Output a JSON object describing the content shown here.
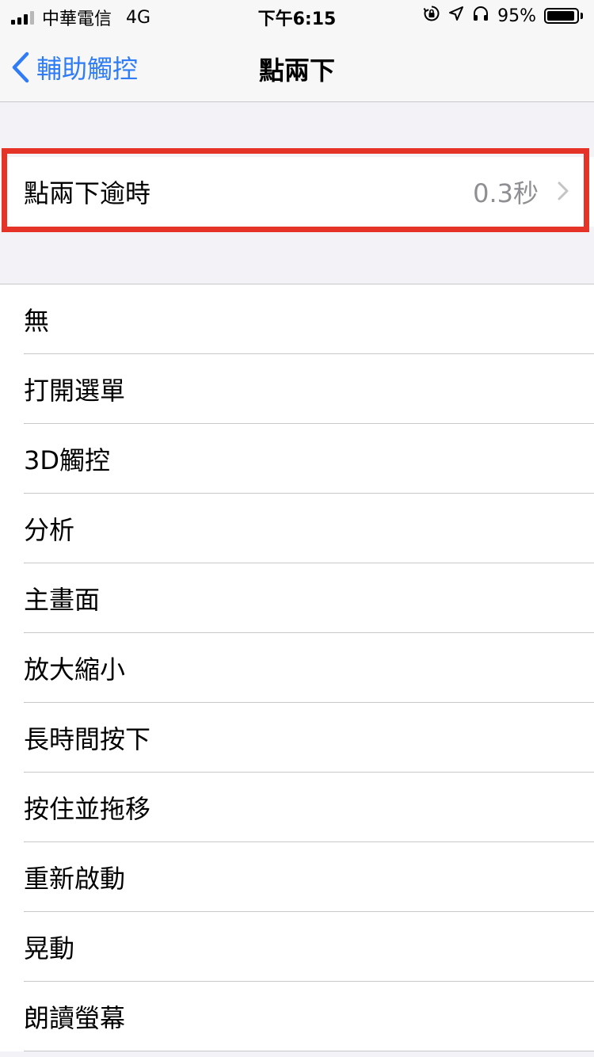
{
  "status_bar": {
    "carrier": "中華電信",
    "network": "4G",
    "time": "下午6:15",
    "battery": "95%",
    "battery_level": 0.95,
    "icons": [
      "orientation-lock-icon",
      "location-arrow-icon",
      "headphones-icon",
      "battery-icon"
    ]
  },
  "nav": {
    "back_label": "輔助觸控",
    "title": "點兩下"
  },
  "timeout": {
    "label": "點兩下逾時",
    "value": "0.3秒"
  },
  "actions": [
    {
      "label": "無"
    },
    {
      "label": "打開選單"
    },
    {
      "label": "3D觸控"
    },
    {
      "label": "分析"
    },
    {
      "label": "主畫面"
    },
    {
      "label": "放大縮小"
    },
    {
      "label": "長時間按下"
    },
    {
      "label": "按住並拖移"
    },
    {
      "label": "重新啟動"
    },
    {
      "label": "晃動"
    },
    {
      "label": "朗讀螢幕"
    }
  ],
  "colors": {
    "accent": "#2f7cf6",
    "highlight": "#e53427",
    "secondary_text": "#8e8e93",
    "background": "#f2f2f7"
  }
}
